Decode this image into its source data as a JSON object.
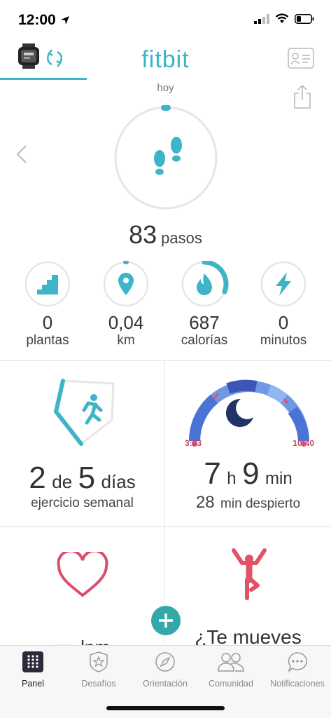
{
  "status_bar": {
    "time": "12:00"
  },
  "header": {
    "title": "fitbit"
  },
  "steps": {
    "date_label": "hoy",
    "value": "83",
    "unit": "pasos",
    "progress": 0.008
  },
  "stats": [
    {
      "value": "0",
      "unit": "plantas",
      "progress": 0.0
    },
    {
      "value": "0,04",
      "unit": "km",
      "progress": 0.01
    },
    {
      "value": "687",
      "unit": "calorías",
      "progress": 0.32
    },
    {
      "value": "0",
      "unit": "minutos",
      "progress": 0.0
    }
  ],
  "exercise": {
    "done": "2",
    "of_label": "de",
    "goal": "5",
    "unit": "días",
    "subtitle": "ejercicio semanal"
  },
  "sleep": {
    "start": "3:03",
    "end": "10:40",
    "hours": "7",
    "hours_unit": "h",
    "minutes": "9",
    "minutes_unit": "min",
    "awake_value": "28",
    "awake_label": "min despierto"
  },
  "heart": {
    "value": "--",
    "unit": "lpm"
  },
  "hourly": {
    "label": "¿Te mueves"
  },
  "tabs": [
    {
      "label": "Panel",
      "icon": "grid-icon",
      "active": true
    },
    {
      "label": "Desafíos",
      "icon": "star-badge-icon",
      "active": false
    },
    {
      "label": "Orientación",
      "icon": "compass-icon",
      "active": false
    },
    {
      "label": "Comunidad",
      "icon": "people-icon",
      "active": false
    },
    {
      "label": "Notificaciones",
      "icon": "chat-bubble-icon",
      "active": false
    }
  ],
  "colors": {
    "accent": "#3db5c7",
    "heart": "#d94f6b",
    "hourly": "#e05367",
    "sleep_dark": "#223366",
    "fab": "#34a7a8"
  }
}
